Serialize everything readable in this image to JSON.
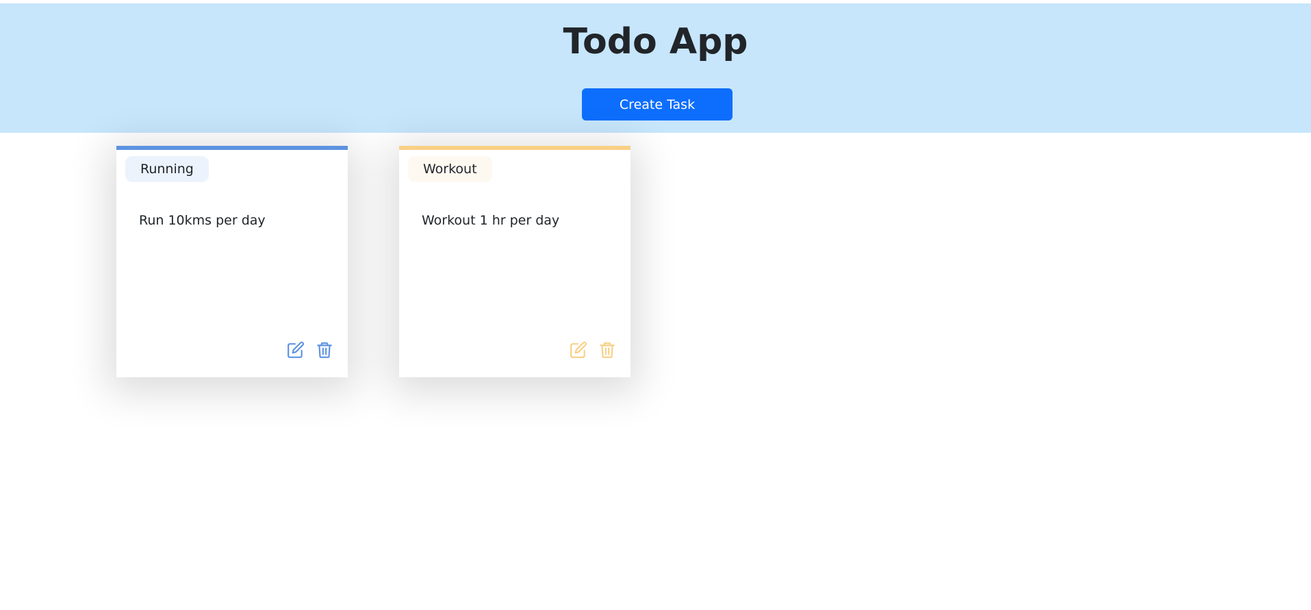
{
  "app": {
    "title": "Todo App"
  },
  "header": {
    "create_button_label": "Create Task"
  },
  "tasks": [
    {
      "category": "Running",
      "description": "Run 10kms per day",
      "colors": {
        "accent": "#5d93e1",
        "tag_bg": "#ecf3fc"
      }
    },
    {
      "category": "Workout",
      "description": "Workout 1 hr per day",
      "colors": {
        "accent": "#f8d085",
        "tag_bg": "#fef9f0"
      }
    }
  ],
  "icons": {
    "edit": "edit-icon",
    "delete": "trash-icon"
  },
  "colors": {
    "header_bg": "#c7e6fb",
    "button_bg": "#0d6efd"
  }
}
